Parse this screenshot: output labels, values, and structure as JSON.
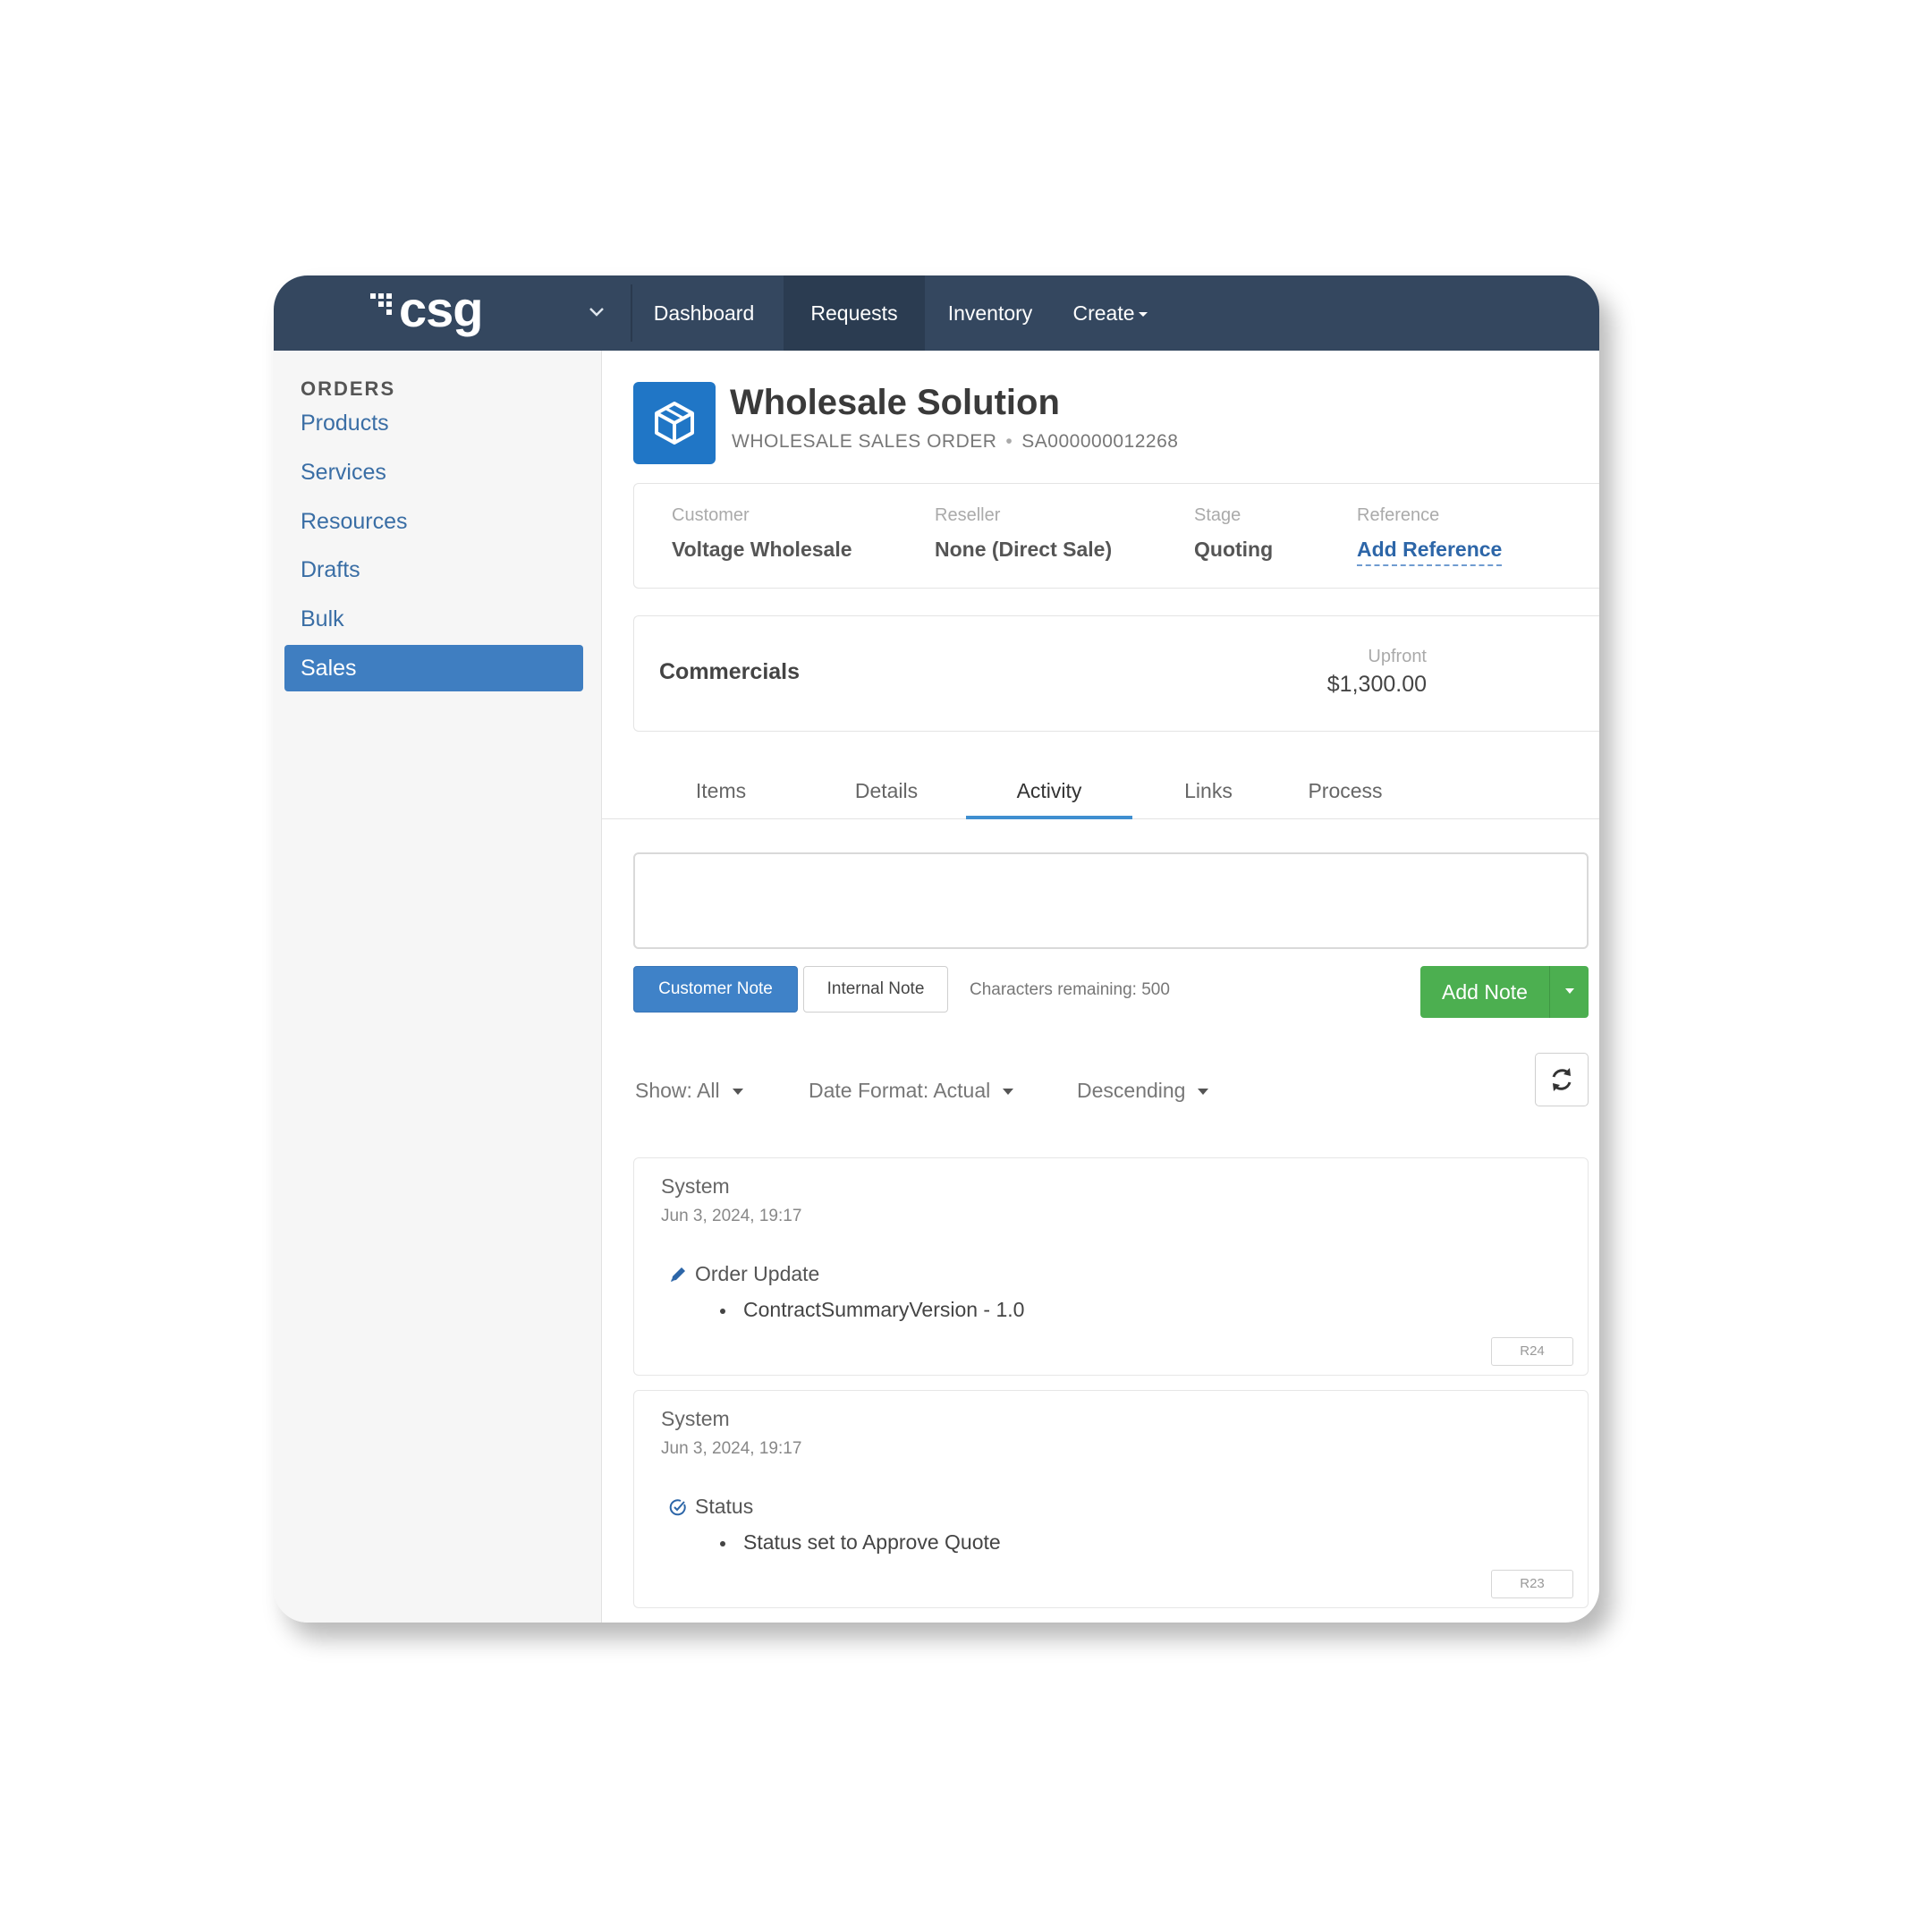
{
  "app": {
    "logo_text": "csg",
    "nav": [
      "Dashboard",
      "Requests",
      "Inventory",
      "Create"
    ],
    "active_nav": "Requests"
  },
  "sidebar": {
    "title": "ORDERS",
    "items": [
      "Products",
      "Services",
      "Resources",
      "Drafts",
      "Bulk",
      "Sales"
    ],
    "active_item": "Sales"
  },
  "header": {
    "title": "Wholesale Solution",
    "type": "WHOLESALE SALES ORDER",
    "separator": "•",
    "order_id": "SA000000012268",
    "icon": "cube-icon"
  },
  "info": {
    "customer_label": "Customer",
    "customer_value": "Voltage Wholesale",
    "reseller_label": "Reseller",
    "reseller_value": "None (Direct Sale)",
    "stage_label": "Stage",
    "stage_value": "Quoting",
    "reference_label": "Reference",
    "reference_value": "Add Reference"
  },
  "commercials": {
    "title": "Commercials",
    "upfront_label": "Upfront",
    "upfront_value": "$1,300.00"
  },
  "tabs": [
    "Items",
    "Details",
    "Activity",
    "Links",
    "Process"
  ],
  "active_tab": "Activity",
  "note": {
    "value": "",
    "customer_note": "Customer Note",
    "internal_note": "Internal Note",
    "chars_remaining": "Characters remaining: 500",
    "add_note": "Add Note"
  },
  "filters": {
    "show": "Show: All",
    "date_format": "Date Format: Actual",
    "order": "Descending"
  },
  "activities": [
    {
      "author": "System",
      "time": "Jun 3, 2024, 19:17",
      "heading": "Order Update",
      "icon": "pencil-icon",
      "detail": "ContractSummaryVersion - 1.0",
      "rev": "R24"
    },
    {
      "author": "System",
      "time": "Jun 3, 2024, 19:17",
      "heading": "Status",
      "icon": "check-circle-icon",
      "detail": "Status set to Approve Quote",
      "rev": "R23"
    }
  ],
  "colors": {
    "topbar": "#34475f",
    "primary": "#3f82c8",
    "success": "#4caf50",
    "link": "#2d66a8"
  }
}
